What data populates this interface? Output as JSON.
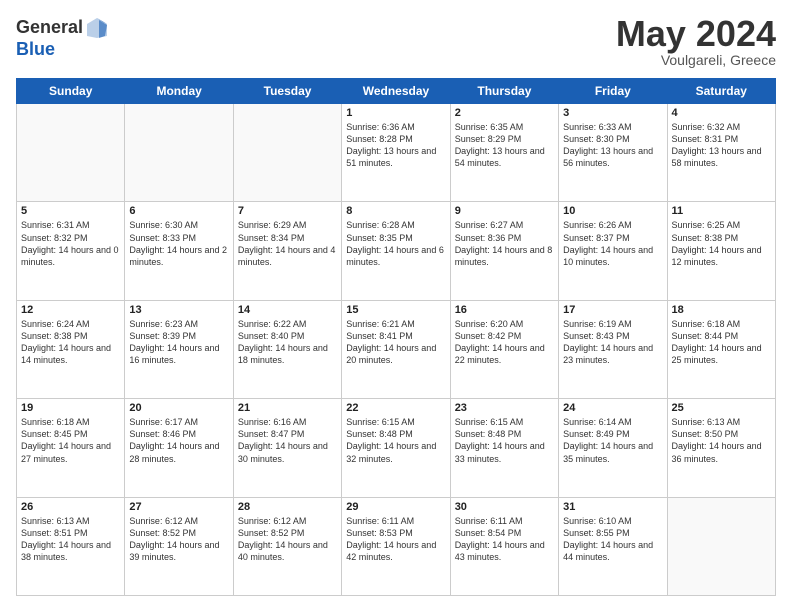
{
  "logo": {
    "general": "General",
    "blue": "Blue"
  },
  "header": {
    "month": "May 2024",
    "location": "Voulgareli, Greece"
  },
  "days_of_week": [
    "Sunday",
    "Monday",
    "Tuesday",
    "Wednesday",
    "Thursday",
    "Friday",
    "Saturday"
  ],
  "weeks": [
    [
      {
        "day": "",
        "sunrise": "",
        "sunset": "",
        "daylight": ""
      },
      {
        "day": "",
        "sunrise": "",
        "sunset": "",
        "daylight": ""
      },
      {
        "day": "",
        "sunrise": "",
        "sunset": "",
        "daylight": ""
      },
      {
        "day": "1",
        "sunrise": "Sunrise: 6:36 AM",
        "sunset": "Sunset: 8:28 PM",
        "daylight": "Daylight: 13 hours and 51 minutes."
      },
      {
        "day": "2",
        "sunrise": "Sunrise: 6:35 AM",
        "sunset": "Sunset: 8:29 PM",
        "daylight": "Daylight: 13 hours and 54 minutes."
      },
      {
        "day": "3",
        "sunrise": "Sunrise: 6:33 AM",
        "sunset": "Sunset: 8:30 PM",
        "daylight": "Daylight: 13 hours and 56 minutes."
      },
      {
        "day": "4",
        "sunrise": "Sunrise: 6:32 AM",
        "sunset": "Sunset: 8:31 PM",
        "daylight": "Daylight: 13 hours and 58 minutes."
      }
    ],
    [
      {
        "day": "5",
        "sunrise": "Sunrise: 6:31 AM",
        "sunset": "Sunset: 8:32 PM",
        "daylight": "Daylight: 14 hours and 0 minutes."
      },
      {
        "day": "6",
        "sunrise": "Sunrise: 6:30 AM",
        "sunset": "Sunset: 8:33 PM",
        "daylight": "Daylight: 14 hours and 2 minutes."
      },
      {
        "day": "7",
        "sunrise": "Sunrise: 6:29 AM",
        "sunset": "Sunset: 8:34 PM",
        "daylight": "Daylight: 14 hours and 4 minutes."
      },
      {
        "day": "8",
        "sunrise": "Sunrise: 6:28 AM",
        "sunset": "Sunset: 8:35 PM",
        "daylight": "Daylight: 14 hours and 6 minutes."
      },
      {
        "day": "9",
        "sunrise": "Sunrise: 6:27 AM",
        "sunset": "Sunset: 8:36 PM",
        "daylight": "Daylight: 14 hours and 8 minutes."
      },
      {
        "day": "10",
        "sunrise": "Sunrise: 6:26 AM",
        "sunset": "Sunset: 8:37 PM",
        "daylight": "Daylight: 14 hours and 10 minutes."
      },
      {
        "day": "11",
        "sunrise": "Sunrise: 6:25 AM",
        "sunset": "Sunset: 8:38 PM",
        "daylight": "Daylight: 14 hours and 12 minutes."
      }
    ],
    [
      {
        "day": "12",
        "sunrise": "Sunrise: 6:24 AM",
        "sunset": "Sunset: 8:38 PM",
        "daylight": "Daylight: 14 hours and 14 minutes."
      },
      {
        "day": "13",
        "sunrise": "Sunrise: 6:23 AM",
        "sunset": "Sunset: 8:39 PM",
        "daylight": "Daylight: 14 hours and 16 minutes."
      },
      {
        "day": "14",
        "sunrise": "Sunrise: 6:22 AM",
        "sunset": "Sunset: 8:40 PM",
        "daylight": "Daylight: 14 hours and 18 minutes."
      },
      {
        "day": "15",
        "sunrise": "Sunrise: 6:21 AM",
        "sunset": "Sunset: 8:41 PM",
        "daylight": "Daylight: 14 hours and 20 minutes."
      },
      {
        "day": "16",
        "sunrise": "Sunrise: 6:20 AM",
        "sunset": "Sunset: 8:42 PM",
        "daylight": "Daylight: 14 hours and 22 minutes."
      },
      {
        "day": "17",
        "sunrise": "Sunrise: 6:19 AM",
        "sunset": "Sunset: 8:43 PM",
        "daylight": "Daylight: 14 hours and 23 minutes."
      },
      {
        "day": "18",
        "sunrise": "Sunrise: 6:18 AM",
        "sunset": "Sunset: 8:44 PM",
        "daylight": "Daylight: 14 hours and 25 minutes."
      }
    ],
    [
      {
        "day": "19",
        "sunrise": "Sunrise: 6:18 AM",
        "sunset": "Sunset: 8:45 PM",
        "daylight": "Daylight: 14 hours and 27 minutes."
      },
      {
        "day": "20",
        "sunrise": "Sunrise: 6:17 AM",
        "sunset": "Sunset: 8:46 PM",
        "daylight": "Daylight: 14 hours and 28 minutes."
      },
      {
        "day": "21",
        "sunrise": "Sunrise: 6:16 AM",
        "sunset": "Sunset: 8:47 PM",
        "daylight": "Daylight: 14 hours and 30 minutes."
      },
      {
        "day": "22",
        "sunrise": "Sunrise: 6:15 AM",
        "sunset": "Sunset: 8:48 PM",
        "daylight": "Daylight: 14 hours and 32 minutes."
      },
      {
        "day": "23",
        "sunrise": "Sunrise: 6:15 AM",
        "sunset": "Sunset: 8:48 PM",
        "daylight": "Daylight: 14 hours and 33 minutes."
      },
      {
        "day": "24",
        "sunrise": "Sunrise: 6:14 AM",
        "sunset": "Sunset: 8:49 PM",
        "daylight": "Daylight: 14 hours and 35 minutes."
      },
      {
        "day": "25",
        "sunrise": "Sunrise: 6:13 AM",
        "sunset": "Sunset: 8:50 PM",
        "daylight": "Daylight: 14 hours and 36 minutes."
      }
    ],
    [
      {
        "day": "26",
        "sunrise": "Sunrise: 6:13 AM",
        "sunset": "Sunset: 8:51 PM",
        "daylight": "Daylight: 14 hours and 38 minutes."
      },
      {
        "day": "27",
        "sunrise": "Sunrise: 6:12 AM",
        "sunset": "Sunset: 8:52 PM",
        "daylight": "Daylight: 14 hours and 39 minutes."
      },
      {
        "day": "28",
        "sunrise": "Sunrise: 6:12 AM",
        "sunset": "Sunset: 8:52 PM",
        "daylight": "Daylight: 14 hours and 40 minutes."
      },
      {
        "day": "29",
        "sunrise": "Sunrise: 6:11 AM",
        "sunset": "Sunset: 8:53 PM",
        "daylight": "Daylight: 14 hours and 42 minutes."
      },
      {
        "day": "30",
        "sunrise": "Sunrise: 6:11 AM",
        "sunset": "Sunset: 8:54 PM",
        "daylight": "Daylight: 14 hours and 43 minutes."
      },
      {
        "day": "31",
        "sunrise": "Sunrise: 6:10 AM",
        "sunset": "Sunset: 8:55 PM",
        "daylight": "Daylight: 14 hours and 44 minutes."
      },
      {
        "day": "",
        "sunrise": "",
        "sunset": "",
        "daylight": ""
      }
    ]
  ]
}
